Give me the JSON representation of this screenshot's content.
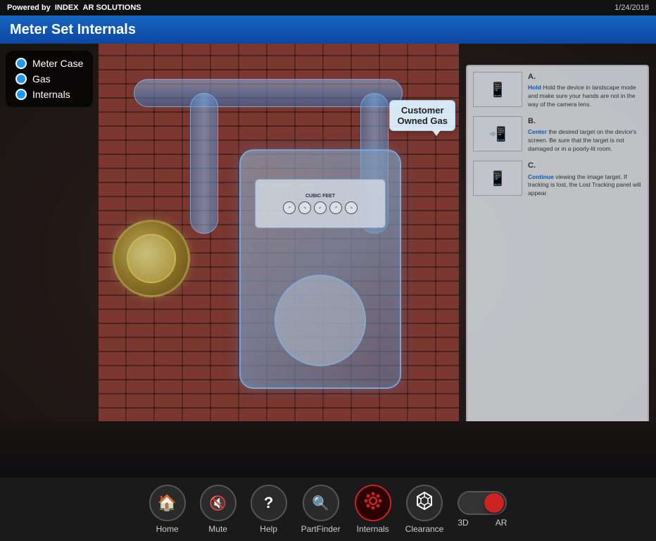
{
  "app": {
    "powered_by_prefix": "Powered by",
    "powered_by_brand": "INDEX",
    "powered_by_suffix": "AR SOLUTIONS",
    "date": "1/24/2018"
  },
  "title_bar": {
    "title": "Meter Set Internals"
  },
  "legend": {
    "items": [
      {
        "id": "meter-case",
        "label": "Meter Case"
      },
      {
        "id": "gas",
        "label": "Gas"
      },
      {
        "id": "internals",
        "label": "Internals"
      }
    ]
  },
  "tooltip": {
    "text_line1": "Customer",
    "text_line2": "Owned Gas"
  },
  "instructions": {
    "intro": "Hold the device in landscape mode and make sure your hands are not in the way of the camera lens.",
    "steps": [
      {
        "letter": "B.",
        "highlight": "Center",
        "text": " the desired target on the device's screen. Be sure that the target is not damaged or in a poorly-lit room."
      },
      {
        "letter": "C.",
        "highlight": "Continue",
        "text": " viewing the image target. If tracking is lost, the Lost Tracking panel will appear."
      }
    ]
  },
  "meter_display": {
    "label": "CUBIC FEET"
  },
  "bottom_nav": {
    "items": [
      {
        "id": "home",
        "label": "Home",
        "icon": "🏠"
      },
      {
        "id": "mute",
        "label": "Mute",
        "icon": "🔇"
      },
      {
        "id": "help",
        "label": "Help",
        "icon": "❓"
      },
      {
        "id": "partfinder",
        "label": "PartFinder",
        "icon": "🔍"
      },
      {
        "id": "internals",
        "label": "Internals",
        "icon": "⚙",
        "active": true
      },
      {
        "id": "clearance",
        "label": "Clearance",
        "icon": "⬡"
      }
    ]
  },
  "toggle": {
    "label_3d": "3D",
    "label_ar": "AR",
    "position": "AR"
  },
  "colors": {
    "accent_blue": "#1565c0",
    "accent_red": "#cc2222",
    "bg_dark": "#1a1a1a",
    "legend_dot": "#2196F3"
  }
}
